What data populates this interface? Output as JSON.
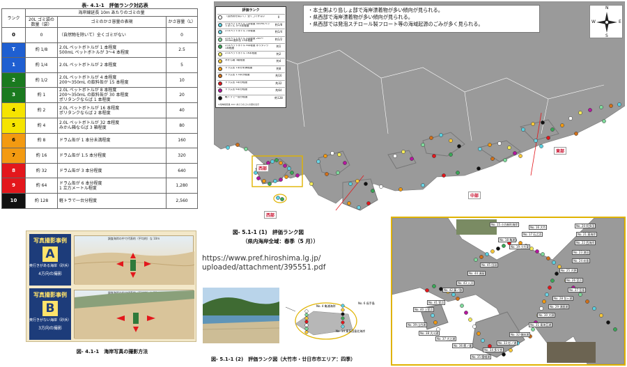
{
  "rank_table": {
    "title": "表- 4.1-1　評価ランク対応表",
    "headers": {
      "rank": "ランク",
      "group": "海岸線延長 10m あたりのゴミの量",
      "count": "20L ゴミ袋の数量（袋）",
      "expr": "ゴミのかさ容量の表現",
      "capacity": "かさ容量（L）"
    },
    "rows": [
      {
        "rank": "0",
        "color": "#ffffff",
        "text_color": "#000000",
        "count": "0",
        "expr": "（自然物を除いて）全くゴミがない",
        "capacity": "0"
      },
      {
        "rank": "T",
        "color": "#1f5fd1",
        "text_color": "#ffffff",
        "count": "約 1/8",
        "expr": "2.0L ペットボトルが 1 本程度\n500mL ペットボトルが 3～4 本程度",
        "capacity": "2.5"
      },
      {
        "rank": "1",
        "color": "#1f5fd1",
        "text_color": "#ffffff",
        "count": "約 1/4",
        "expr": "2.0L ペットボトルが 2 本程度",
        "capacity": "5"
      },
      {
        "rank": "2",
        "color": "#1a7a1f",
        "text_color": "#ffffff",
        "count": "約 1/2",
        "expr": "2.0L ペットボトルが 4 本程度\n200～350mL の飲料缶が 15 本程度",
        "capacity": "10"
      },
      {
        "rank": "3",
        "color": "#1a7a1f",
        "text_color": "#ffffff",
        "count": "約 1",
        "expr": "2.0L ペットボトルが 8 本程度\n200～350mL の飲料缶が 30 本程度\nポリタンクならば 1 本程度",
        "capacity": "20"
      },
      {
        "rank": "4",
        "color": "#f5e400",
        "text_color": "#000000",
        "count": "約 2",
        "expr": "2.0L ペットボトルが 16 本程度\nポリタンクならば 2 本程度",
        "capacity": "40"
      },
      {
        "rank": "5",
        "color": "#f5e400",
        "text_color": "#000000",
        "count": "約 4",
        "expr": "2.0L ペットボトルが 32 本程度\nみかん箱ならば 3 箱程度",
        "capacity": "80"
      },
      {
        "rank": "6",
        "color": "#f39a11",
        "text_color": "#000000",
        "count": "約 8",
        "expr": "ドラム缶が 1 本分未満程度",
        "capacity": "160"
      },
      {
        "rank": "7",
        "color": "#f39a11",
        "text_color": "#000000",
        "count": "約 16",
        "expr": "ドラム缶が 1.5 本分程度",
        "capacity": "320"
      },
      {
        "rank": "8",
        "color": "#e3171c",
        "text_color": "#ffffff",
        "count": "約 32",
        "expr": "ドラム缶が 3 本分程度",
        "capacity": "640"
      },
      {
        "rank": "9",
        "color": "#e3171c",
        "text_color": "#ffffff",
        "count": "約 64",
        "expr": "ドラム缶が 6 本分程度\n1 立方メートル程度",
        "capacity": "1,280"
      },
      {
        "rank": "10",
        "color": "#111111",
        "text_color": "#ffffff",
        "count": "約 128",
        "expr": "軽トラで一台分程度",
        "capacity": "2,560"
      }
    ]
  },
  "photo_methods": {
    "caption": "図- 4.1-1　海岸写真の撮影方法",
    "blocks": [
      {
        "label": "写真撮影事例",
        "letter": "A",
        "desc": "奥行きがある海岸（砂浜）",
        "sub": "4方向の撮影",
        "illus_caption": "調査海岸の中で代表的（平均的）な 10m"
      },
      {
        "label": "写真撮影事例",
        "letter": "B",
        "desc": "奥行きがない海岸（砂浜）",
        "sub": "3方向の撮影",
        "illus_caption": "調査海岸の中で代表的（平均的）な 10m"
      }
    ]
  },
  "legend": {
    "title": "評価ランク",
    "col_rank": "ランク",
    "col_desc": "かさ容量の表現",
    "col_val": "20L 袋の数量",
    "footnote": "※海岸線延長 10m あたりのゴミの量を表示",
    "items": [
      {
        "rank": "0",
        "color": "#ffffff",
        "desc": "（自然物を除いて）全くゴミがない",
        "val": "0"
      },
      {
        "rank": "T",
        "color": "#5ad0e0",
        "desc": "2.0Lペットボトル 1本程度 500mLペットボトル 3～4本程度",
        "val": "約1/8"
      },
      {
        "rank": "1",
        "color": "#6bd4e5",
        "desc": "2.0Lペットボトル 2本程度",
        "val": "約1/4"
      },
      {
        "rank": "2",
        "color": "#7fd99b",
        "desc": "2.0Lペットボトル 4本程度 200～350mL飲料缶 15本程度",
        "val": "約1/2"
      },
      {
        "rank": "3",
        "color": "#3aa657",
        "desc": "2.0Lペットボトル 8本程度 ポリタンク 1本程度",
        "val": "約1"
      },
      {
        "rank": "4",
        "color": "#f3ea5a",
        "desc": "2.0Lペットボトル 16本程度",
        "val": "約2"
      },
      {
        "rank": "5",
        "color": "#f7c83a",
        "desc": "みかん箱 3箱程度",
        "val": "約4"
      },
      {
        "rank": "6",
        "color": "#f39a11",
        "desc": "ドラム缶 1本分未満程度",
        "val": "約8"
      },
      {
        "rank": "7",
        "color": "#d0701a",
        "desc": "ドラム缶 1.5本分程度",
        "val": "約16"
      },
      {
        "rank": "8",
        "color": "#e3171c",
        "desc": "ドラム缶 3本分程度",
        "val": "約32"
      },
      {
        "rank": "9",
        "color": "#b5179e",
        "desc": "ドラム缶 6本分程度",
        "val": "約64"
      },
      {
        "rank": "10",
        "color": "#111111",
        "desc": "軽トラで一台分程度",
        "val": "約128"
      }
    ]
  },
  "notes": [
    "・本土側より島しょ部で海岸漂着物が多い傾向が見られる。",
    "・県西部で海岸漂着物が多い傾向が見られる。",
    "・県西部では発泡スチロール製フロート等の海域起源のごみが多く見られる。"
  ],
  "compass": {
    "n": "N",
    "s": "S",
    "e": "E",
    "w": "W"
  },
  "regions": {
    "west": "西部",
    "central": "中部",
    "east": "東部"
  },
  "map1": {
    "caption": "図- 5.1-1 (1)　評価ランク図",
    "sub": "（県内海岸全域：春季（5 月））"
  },
  "source_url": [
    "https://www.pref.hiroshima.lg.jp/",
    "uploaded/attachment/395551.pdf"
  ],
  "map2": {
    "caption": "図- 5.1-1 (2)　評価ランク図（大竹市・廿日市市エリア：四季）",
    "labels": [
      "No. 4 亀浦海岸",
      "No. 6 長手島",
      "No. 14 東多田島北海岸"
    ]
  },
  "detail_sites": [
    "No. 15 小方新町海岸",
    "No. 16 大竹",
    "No. 17 石之浜",
    "No. 18 亀浦",
    "No. 19 小方東",
    "No. 20 阿多田",
    "No. 21 東海岸",
    "No. 22 西海岸",
    "No. 23 津田",
    "No. 24 玖島",
    "No. 25 大野",
    "No. 26 宮浜",
    "No. 27 宮島",
    "No. 28 包ヶ浦",
    "No. 29 須屋浦",
    "No. 30 大頭",
    "No. 31 青海苔浦",
    "No. 32 御床浦",
    "No. 33 杉ノ浦",
    "No. 34 多々良",
    "No. 35 腰細浦",
    "No. 36 鷹ノ巣",
    "No. 37 大江浦",
    "No. 38 大川浦",
    "No. 39 山白浦",
    "No. 40 上室浜",
    "No. 41 室浜",
    "No. 42 藤ノ脇",
    "No. 43 入浜",
    "No. 44 須屋",
    "No. 45 田淵"
  ],
  "colors": {
    "map_gray": "#9a9a9a",
    "sea": "#ffffff",
    "accent_yellow": "#e0b300",
    "region_red": "#c8102e"
  }
}
